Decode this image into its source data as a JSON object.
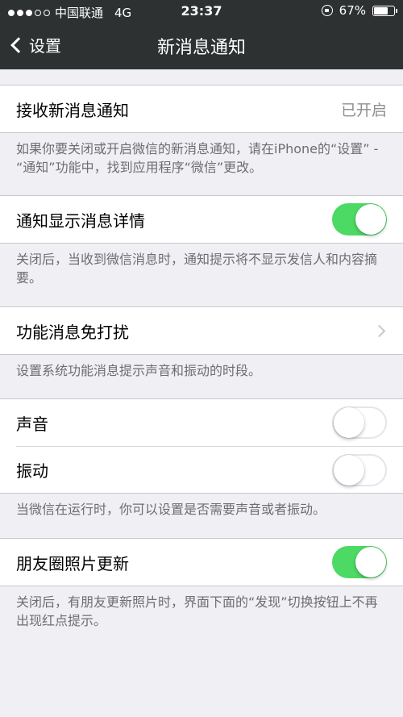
{
  "status_bar": {
    "signal_dots_full": 3,
    "signal_dots_total": 5,
    "carrier": "中国联通",
    "network": "4G",
    "time": "23:37",
    "battery": "67%"
  },
  "nav": {
    "back_label": "设置",
    "title": "新消息通知"
  },
  "sections": [
    {
      "rows": [
        {
          "label": "接收新消息通知",
          "value": "已开启"
        }
      ],
      "note": "如果你要关闭或开启微信的新消息通知，请在iPhone的“设置” - “通知”功能中，找到应用程序“微信”更改。"
    },
    {
      "rows": [
        {
          "label": "通知显示消息详情",
          "toggle": true
        }
      ],
      "note": "关闭后，当收到微信消息时，通知提示将不显示发信人和内容摘要。"
    },
    {
      "rows": [
        {
          "label": "功能消息免打扰"
        }
      ],
      "note": "设置系统功能消息提示声音和振动的时段。"
    },
    {
      "rows": [
        {
          "label": "声音",
          "toggle": false
        },
        {
          "label": "振动",
          "toggle": false
        }
      ],
      "note": "当微信在运行时，你可以设置是否需要声音或者振动。"
    },
    {
      "rows": [
        {
          "label": "朋友圈照片更新",
          "toggle": true
        }
      ],
      "note": "关闭后，有朋友更新照片时，界面下面的“发现”切换按钮上不再出现红点提示。"
    }
  ],
  "colors": {
    "toggle_on": "#4cd964",
    "nav_background": "#2e3132",
    "page_background": "#efeff4"
  }
}
